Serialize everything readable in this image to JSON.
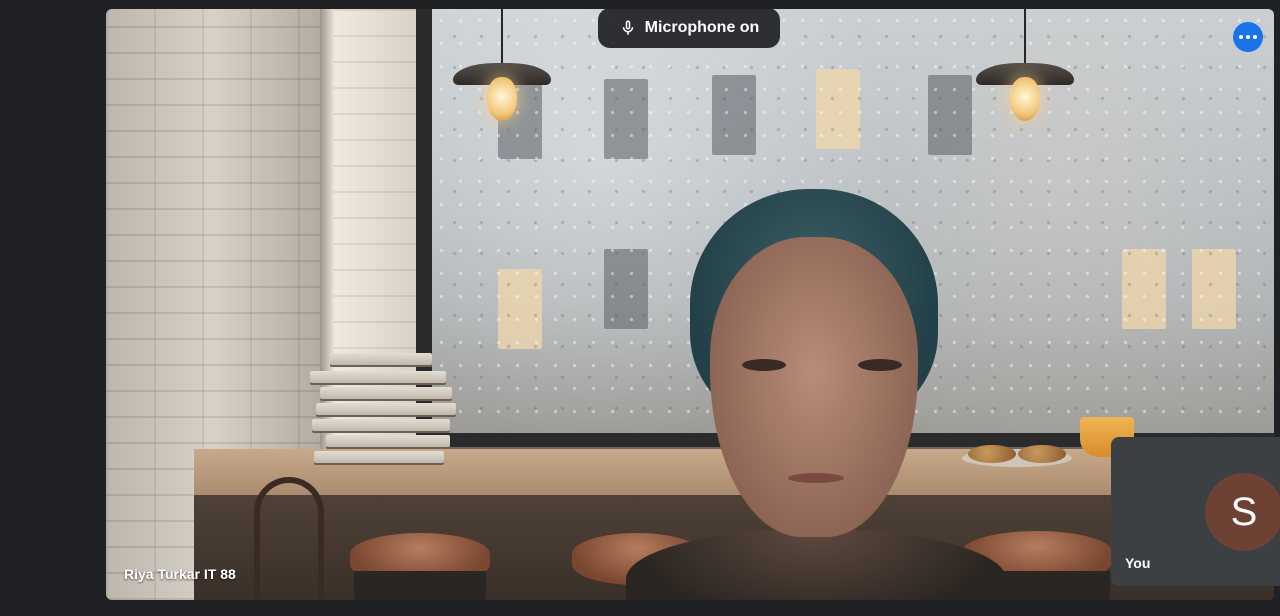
{
  "meeting": {
    "mic_status_label": "Microphone on",
    "mic_icon": "microphone-icon",
    "more_options_icon": "more-horiz-icon",
    "accent_color": "#1a73e8"
  },
  "main_participant": {
    "name": "Riya Turkar IT 88"
  },
  "self_view": {
    "avatar_initial": "S",
    "avatar_color": "#6d4235",
    "label": "You"
  }
}
